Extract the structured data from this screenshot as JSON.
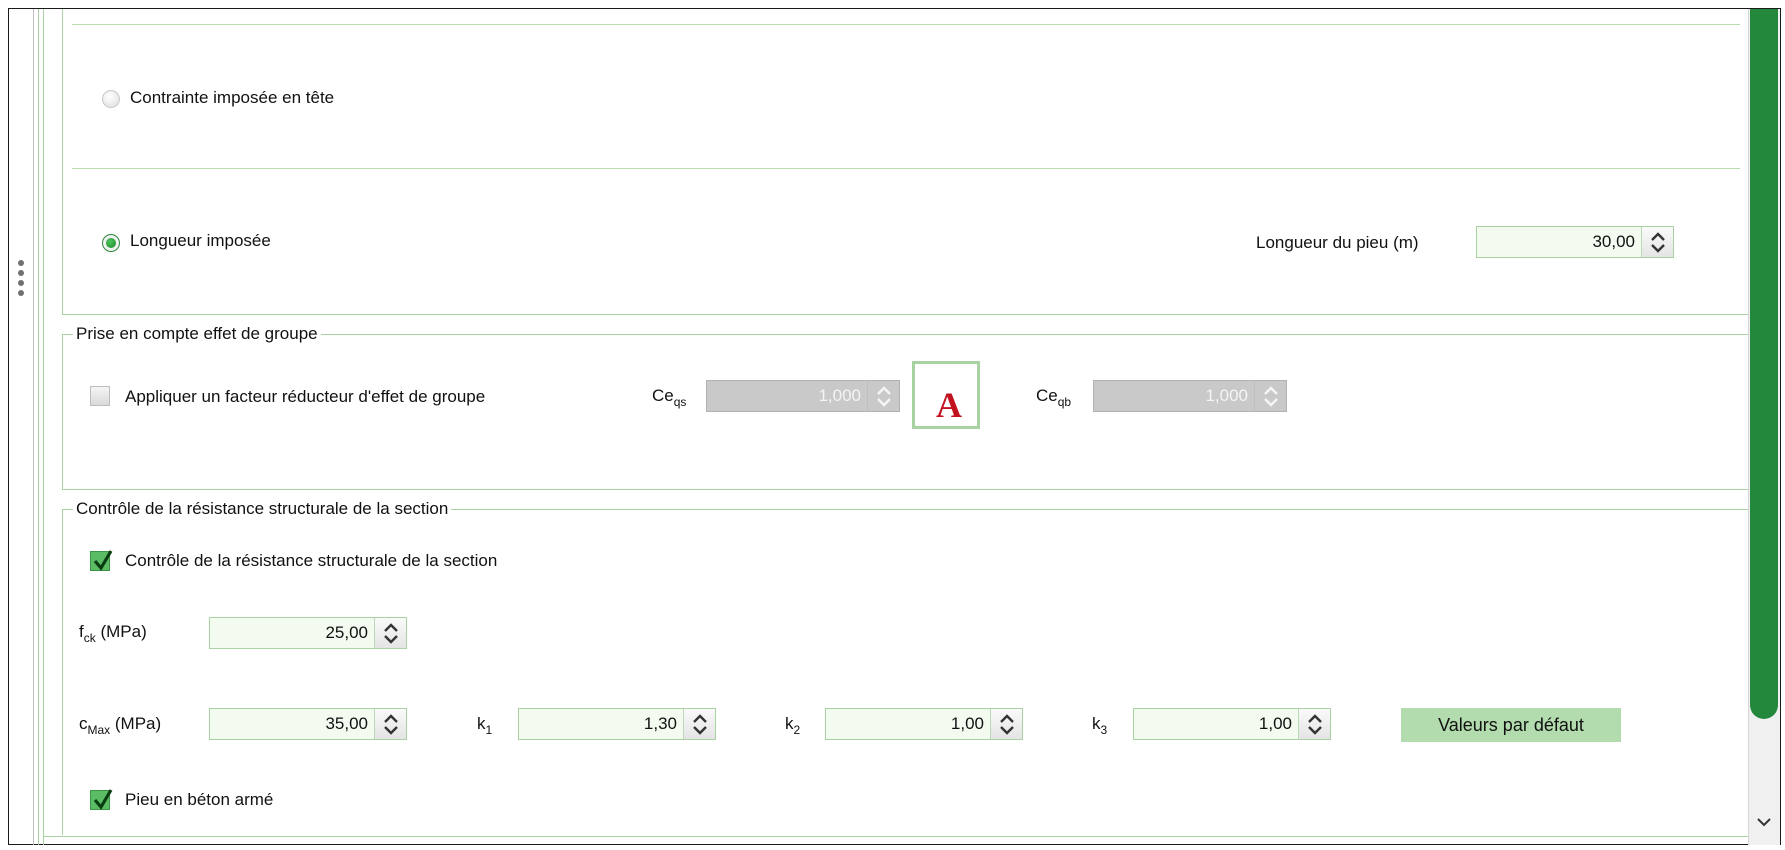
{
  "mode_options": {
    "head_stress": {
      "label": "Contrainte imposée en tête",
      "selected": false
    },
    "imposed_length": {
      "label": "Longueur imposée",
      "selected": true
    }
  },
  "pile_length": {
    "label": "Longueur du pieu (m)",
    "value": "30,00"
  },
  "group_effect": {
    "legend": "Prise en compte effet de groupe",
    "apply_checkbox": {
      "label": "Appliquer un facteur réducteur d'effet de groupe",
      "checked": false
    },
    "ce_qs": {
      "symbol": "Ce",
      "subscript": "qs",
      "value": "1,000"
    },
    "ce_qb": {
      "symbol": "Ce",
      "subscript": "qb",
      "value": "1,000"
    },
    "icon_letter": "A"
  },
  "structural": {
    "legend": "Contrôle de la résistance structurale de la section",
    "control_checkbox": {
      "label": "Contrôle de la résistance structurale de la section",
      "checked": true
    },
    "fck": {
      "symbol": "f",
      "subscript": "ck",
      "unit": " (MPa)",
      "value": "25,00"
    },
    "cmax": {
      "symbol": "c",
      "subscript": "Max",
      "unit": " (MPa)",
      "value": "35,00"
    },
    "k1": {
      "symbol": "k",
      "subscript": "1",
      "value": "1,30"
    },
    "k2": {
      "symbol": "k",
      "subscript": "2",
      "value": "1,00"
    },
    "k3": {
      "symbol": "k",
      "subscript": "3",
      "value": "1,00"
    },
    "defaults_button": "Valeurs par défaut",
    "reinforced_checkbox": {
      "label": "Pieu en béton armé",
      "checked": true
    }
  },
  "colors": {
    "accent_green": "#2a8a3e",
    "field_border": "#a9d2a2",
    "button_bg": "#b2dcae"
  }
}
